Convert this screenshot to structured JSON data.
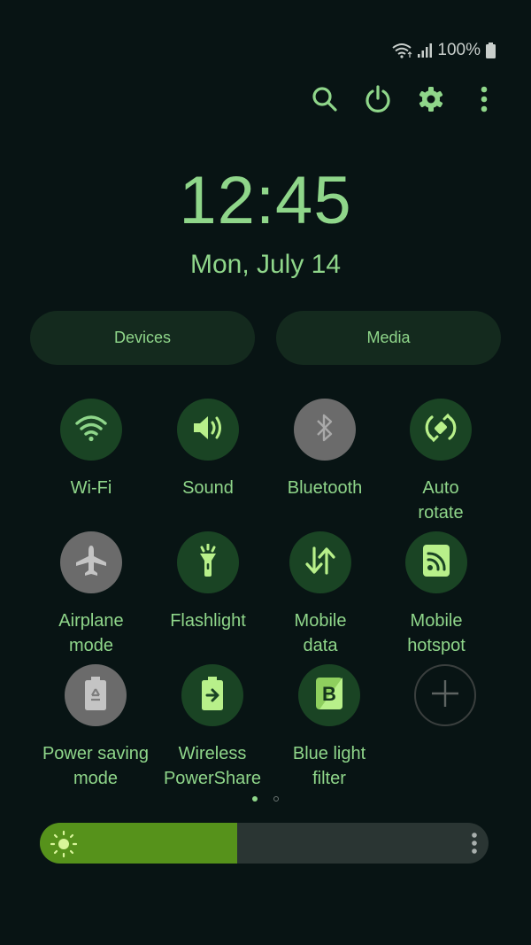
{
  "status_bar": {
    "wifi_icon": "wifi-icon",
    "signal_icon": "cellular-signal-icon",
    "battery_percent": "100%",
    "battery_icon": "battery-full-icon"
  },
  "top_actions": [
    {
      "name": "search",
      "icon": "search-icon"
    },
    {
      "name": "power",
      "icon": "power-icon"
    },
    {
      "name": "settings",
      "icon": "gear-icon"
    },
    {
      "name": "more",
      "icon": "more-vertical-icon"
    }
  ],
  "clock": {
    "time": "12:45",
    "date": "Mon, July 14"
  },
  "pills": {
    "devices": "Devices",
    "media": "Media"
  },
  "tiles": [
    {
      "label": "Wi-Fi",
      "icon": "wifi-icon",
      "state": "on"
    },
    {
      "label": "Sound",
      "icon": "speaker-icon",
      "state": "on"
    },
    {
      "label": "Bluetooth",
      "icon": "bluetooth-icon",
      "state": "off"
    },
    {
      "label": "Auto\nrotate",
      "icon": "auto-rotate-icon",
      "state": "on"
    },
    {
      "label": "Airplane\nmode",
      "icon": "airplane-icon",
      "state": "off"
    },
    {
      "label": "Flashlight",
      "icon": "flashlight-icon",
      "state": "on"
    },
    {
      "label": "Mobile\ndata",
      "icon": "mobile-data-icon",
      "state": "on"
    },
    {
      "label": "Mobile\nhotspot",
      "icon": "hotspot-icon",
      "state": "on"
    },
    {
      "label": "Power saving\nmode",
      "icon": "power-saving-icon",
      "state": "off"
    },
    {
      "label": "Wireless\nPowerShare",
      "icon": "wireless-powershare-icon",
      "state": "on"
    },
    {
      "label": "Blue light\nfilter",
      "icon": "blue-light-filter-icon",
      "state": "on"
    },
    {
      "label": "",
      "icon": "add-icon",
      "state": "add"
    }
  ],
  "page_indicator": {
    "current_page": 1,
    "total_pages": 2
  },
  "brightness": {
    "level_percent": 44,
    "icon": "sun-icon",
    "more_icon": "more-vertical-icon"
  },
  "colors": {
    "background": "#081414",
    "accent": "#8fd68a",
    "tile_on": "#1a4424",
    "tile_off": "#6b6b6b",
    "brightness_fill": "#56921b"
  }
}
